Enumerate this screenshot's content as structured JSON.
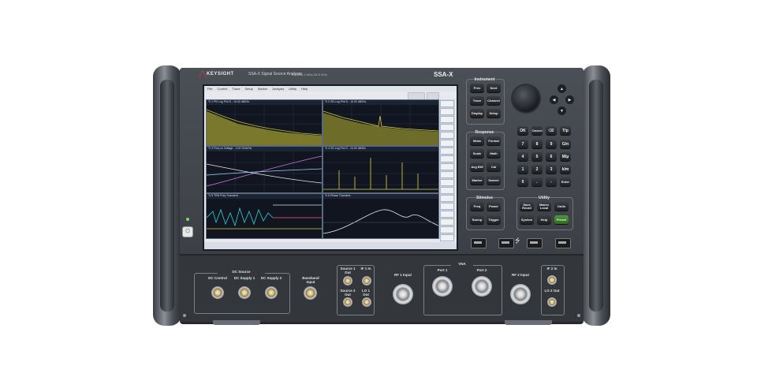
{
  "header": {
    "brand": "KEYSIGHT",
    "product": "SSA-X Signal Source Analyzer",
    "spec": "E5055A   1 MHz-26.5 GHz",
    "model": "SSA-X"
  },
  "screen": {
    "menus": [
      "File",
      "Control",
      "Trace",
      "Setup",
      "Marker",
      "Analysis",
      "Utility",
      "Help"
    ],
    "plots": [
      {
        "title": "Tr 1 PN Log Plot S - 10.00 dB/Div"
      },
      {
        "title": "Tr 2 SN Log Plot S - 10.00 dB/Div"
      },
      {
        "title": "Tr 3 Freq vs Voltage - 1.00 GHz/Div"
      },
      {
        "title": "Tr 4 SS Log Plot S - 10.00 dB/Div"
      },
      {
        "title": "Tr 5 TRN Freq Transient"
      },
      {
        "title": "Tr 6 Phase Transient"
      }
    ]
  },
  "instrument_section": {
    "title": "Instrument",
    "buttons": [
      "Prev",
      "Next",
      "Trace",
      "Channel",
      "Display",
      "Setup"
    ]
  },
  "response_section": {
    "title": "Response",
    "buttons": [
      "Meas",
      "Format",
      "Scale",
      "Math",
      "Avg BW",
      "Cal",
      "Marker",
      "Search"
    ]
  },
  "stimulus_section": {
    "title": "Stimulus",
    "buttons": [
      "Freq",
      "Power",
      "Sweep",
      "Trigger"
    ]
  },
  "utility_section": {
    "title": "Utility",
    "buttons": [
      "Save Recall",
      "Macro Local",
      "Undo",
      "System",
      "Help",
      "Preset"
    ]
  },
  "keypad": {
    "top_row": [
      "OK",
      "Cancel",
      "⌫",
      "T/p"
    ],
    "rows": [
      [
        "7",
        "8",
        "9",
        "G/n"
      ],
      [
        "4",
        "5",
        "6",
        "M/μ"
      ],
      [
        "1",
        "2",
        "3",
        "k/m"
      ],
      [
        "0",
        ".",
        "-",
        "Enter"
      ]
    ]
  },
  "nav_arrows": [
    "▲",
    "◀",
    "▶",
    "▼"
  ],
  "power_symbol": "⏻",
  "connectors": {
    "dc_group_title": "DC Source",
    "dc_control": "DC Control",
    "dc_supply1": "DC Supply 1",
    "dc_supply2": "DC Supply 2",
    "baseband": "Baseband Input",
    "source1_out": "Source 1 Out",
    "source2_out": "Source 2 Out",
    "if1_in": "IF 1 In",
    "lo1_out": "LO 1 Out",
    "rf1_input": "RF 1 Input",
    "vna_title": "VNA",
    "port1": "Port 1",
    "port2": "Port 2",
    "rf2_input": "RF 2 Input",
    "if2_in": "IF 2 In",
    "lo2_out": "LO 2 Out"
  }
}
